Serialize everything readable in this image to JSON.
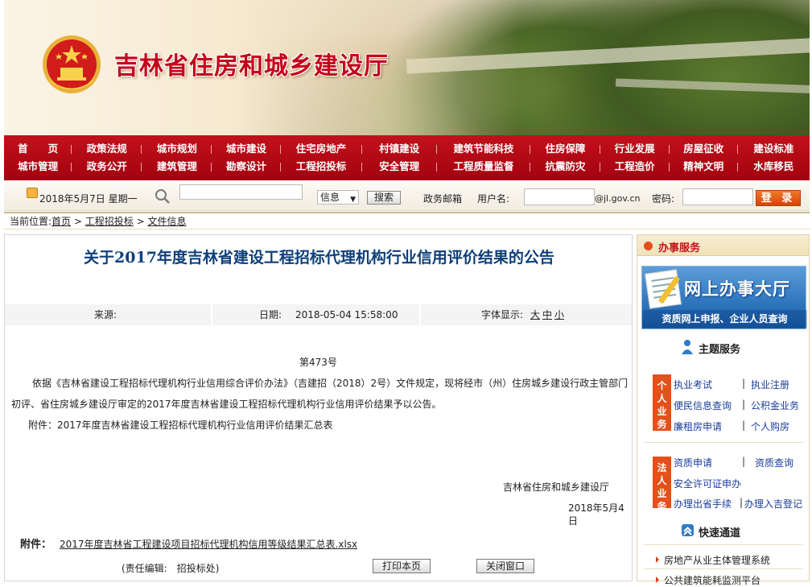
{
  "header": {
    "site_title": "吉林省住房和城乡建设厅"
  },
  "nav": {
    "row1": [
      "首　　页",
      "政策法规",
      "城市规划",
      "城市建设",
      "住宅房地产",
      "村镇建设",
      "建筑节能科技",
      "住房保障",
      "行业发展",
      "房屋征收",
      "建设标准"
    ],
    "row2": [
      "城市管理",
      "政务公开",
      "建筑管理",
      "勘察设计",
      "工程招投标",
      "安全管理",
      "工程质量监督",
      "抗震防灾",
      "工程造价",
      "精神文明",
      "水库移民"
    ]
  },
  "toolbar": {
    "date": "2018年5月7日  星期一",
    "search_scope": "信息",
    "search_button": "搜索",
    "mail_label": "政务邮箱",
    "username_label": "用户名:",
    "mail_domain": "@jl.gov.cn",
    "password_label": "密码:",
    "login_button": "登 录"
  },
  "breadcrumb": {
    "prefix": "当前位置:",
    "home": "首页",
    "sep1": " > ",
    "section": "工程招投标",
    "sep2": " > ",
    "page": "文件信息"
  },
  "article": {
    "title": "关于2017年度吉林省建设工程招标代理机构行业信用评价结果的公告",
    "source_label": "来源:",
    "date_label": "日期:",
    "date_value": "2018-05-04 15:58:00",
    "font_label": "字体显示:",
    "font_sizes": [
      "大",
      "中",
      "小"
    ],
    "doc_number": "第473号",
    "para1_line1": "依据《吉林省建设工程招标代理机构行业信用综合评价办法》（吉建招（2018）2号）文件规定，现将经市（州）住房城乡建设行政主管部门",
    "para1_line2": "初评、省住房城乡建设厅审定的2017年度吉林省建设工程招标代理机构行业信用评价结果予以公告。",
    "para2": "附件：2017年度吉林省建设工程招标代理机构行业信用评价结果汇总表",
    "signature": "吉林省住房和城乡建设厅",
    "sign_date": "2018年5月4日",
    "attachment_label": "附件：",
    "attachment_link": "2017年度吉林省工程建设项目招标代理机构信用等级结果汇总表.xlsx",
    "editor": "(责任编辑:　招投标处)",
    "print_button": "打印本页",
    "close_button": "关闭窗口"
  },
  "sidebar": {
    "service_title": "办事服务",
    "hall_title": "网上办事大厅",
    "hall_subtitle": "资质网上申报、企业人员查询",
    "theme_title": "主题服务",
    "personal_tab": "个人业务",
    "personal_items": [
      "执业考试",
      "执业注册",
      "便民信息查询",
      "公积金业务",
      "廉租房申请",
      "个人购房"
    ],
    "legal_tab": "法人业务",
    "legal_items": [
      "资质申请",
      "资质查询",
      "安全许可证申办",
      "办理出省手续",
      "办理入吉登记"
    ],
    "separator": "|",
    "quick_title": "快速通道",
    "quick_links": [
      "房地产从业主体管理系统",
      "公共建筑能耗监测平台"
    ]
  }
}
